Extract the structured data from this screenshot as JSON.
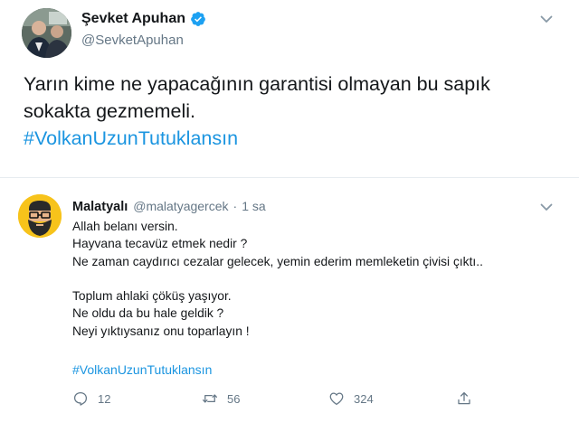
{
  "main_tweet": {
    "author_name": "Şevket Apuhan",
    "author_handle": "@SevketApuhan",
    "verified": true,
    "text_lines": [
      "Yarın kime ne yapacağının garantisi olmayan bu sapık",
      "sokakta gezmemeli."
    ],
    "hashtag": "#VolkanUzunTutuklansın",
    "menu_icon": "chevron-down-icon"
  },
  "reply_tweet": {
    "author_name": "Malatyalı",
    "author_handle": "@malatyagercek",
    "separator": "·",
    "time": "1 sa",
    "menu_icon": "chevron-down-icon",
    "text_lines": [
      "Allah belanı versin.",
      "Hayvana tecavüz etmek nedir ?",
      "Ne zaman caydırıcı cezalar gelecek, yemin ederim memleketin çivisi çıktı..",
      "",
      "Toplum ahlaki çöküş yaşıyor.",
      "Ne oldu da bu hale geldik ?",
      "Neyi yıktıysanız onu toparlayın !"
    ],
    "hashtag": "#VolkanUzunTutuklansın",
    "actions": {
      "reply_count": "12",
      "retweet_count": "56",
      "like_count": "324"
    }
  },
  "colors": {
    "text": "#14171a",
    "secondary": "#657786",
    "link": "#1b95e0",
    "verified": "#1da1f2",
    "divider": "#e6ecf0",
    "reply_avatar_bg": "#f7c31b"
  }
}
